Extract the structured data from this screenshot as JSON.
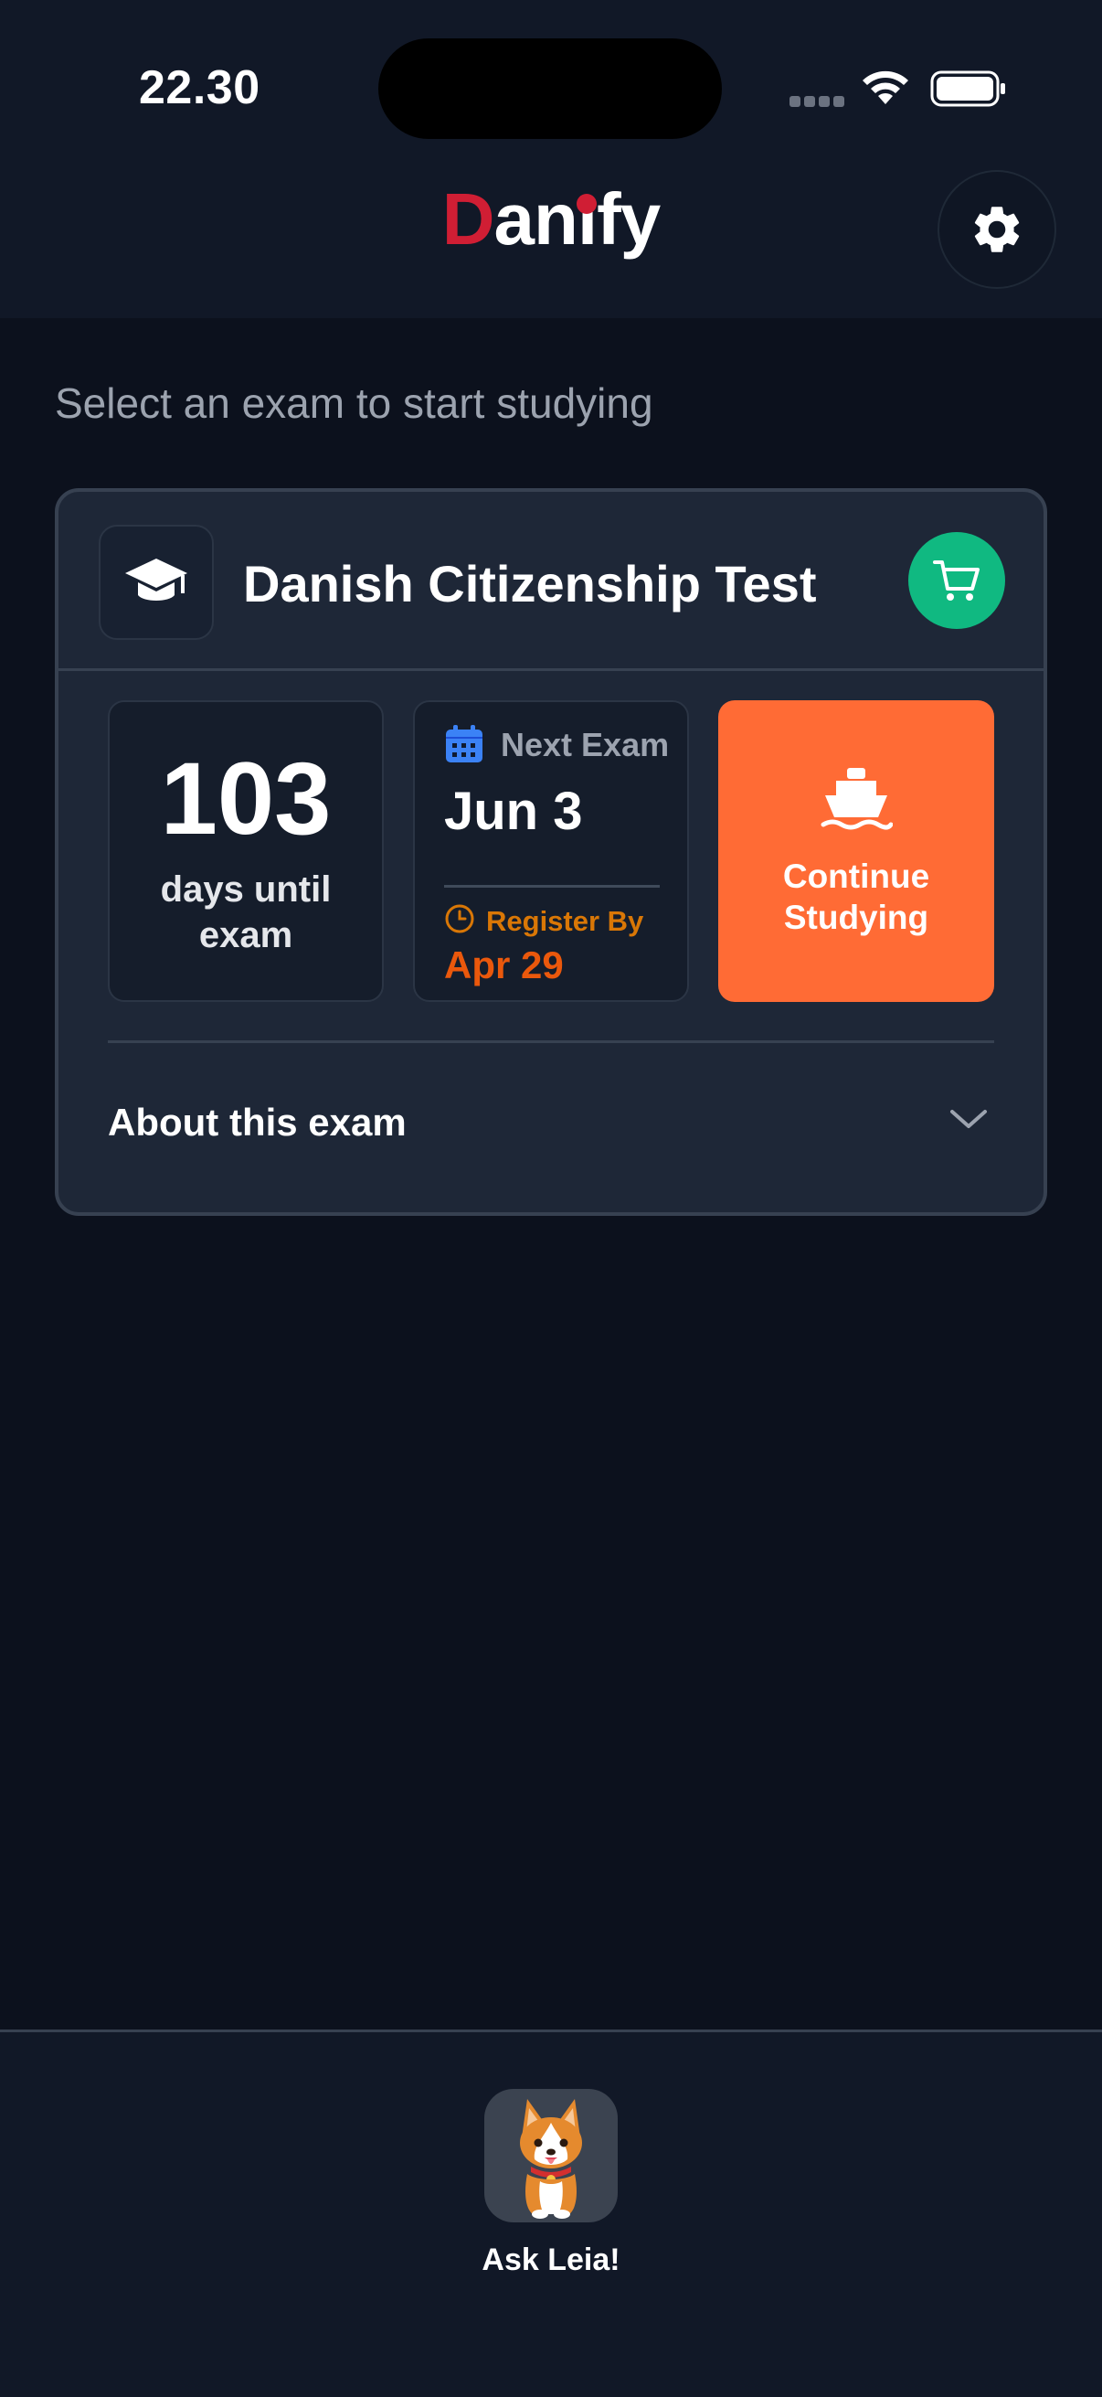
{
  "status_bar": {
    "time": "22.30"
  },
  "header": {
    "title_first_letter": "D",
    "title_part2": "an",
    "title_i": "ı",
    "title_part3": "fy",
    "settings_icon": "gear-icon",
    "brand_color": "#d01e34"
  },
  "main": {
    "subtitle": "Select an exam to start studying",
    "exam_card": {
      "title": "Danish Citizenship Test",
      "cap_icon": "graduation-cap-icon",
      "cart_icon": "shopping-cart-icon",
      "days_count": "103",
      "days_label": "days until exam",
      "next_exam_label": "Next Exam",
      "next_exam_date": "Jun 3",
      "register_label": "Register By",
      "register_date": "Apr 29",
      "continue_label": "Continue Studying",
      "continue_icon": "ship-icon",
      "about_label": "About this exam",
      "colors": {
        "continue": "#ff6b35",
        "cart": "#10b981",
        "register": "#ea580c",
        "calendar": "#3b82f6"
      }
    }
  },
  "bottom_bar": {
    "ask_label": "Ask Leia!",
    "ask_icon": "corgi-avatar-icon"
  }
}
